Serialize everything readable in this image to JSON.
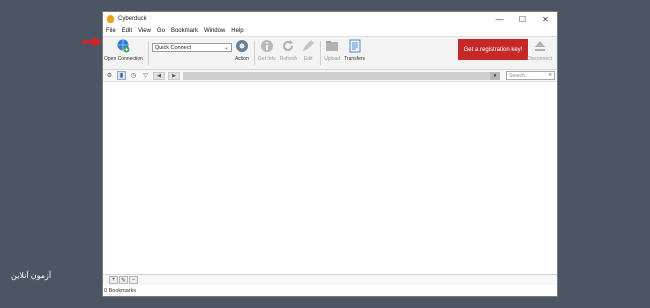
{
  "window": {
    "title": "Cyberduck"
  },
  "titlebar": {
    "minimize": "—",
    "maximize": "☐",
    "close": "✕"
  },
  "menu": [
    "File",
    "Edit",
    "View",
    "Go",
    "Bookmark",
    "Window",
    "Help"
  ],
  "toolbar": {
    "open_connection": "Open Connection",
    "quick_connect": "Quick Connect",
    "action": "Action",
    "get_info": "Get Info",
    "refresh": "Refresh",
    "edit": "Edit",
    "upload": "Upload",
    "transfers": "Transfers",
    "registration": "Get a registration key!",
    "disconnect": "Disconnect"
  },
  "navbar": {
    "search_placeholder": "Search..."
  },
  "bottom": {
    "add": "+",
    "edit": "✎",
    "remove": "−"
  },
  "status": {
    "text": "0 Bookmarks"
  },
  "watermark": {
    "logo": "آزمون آنلاین"
  }
}
